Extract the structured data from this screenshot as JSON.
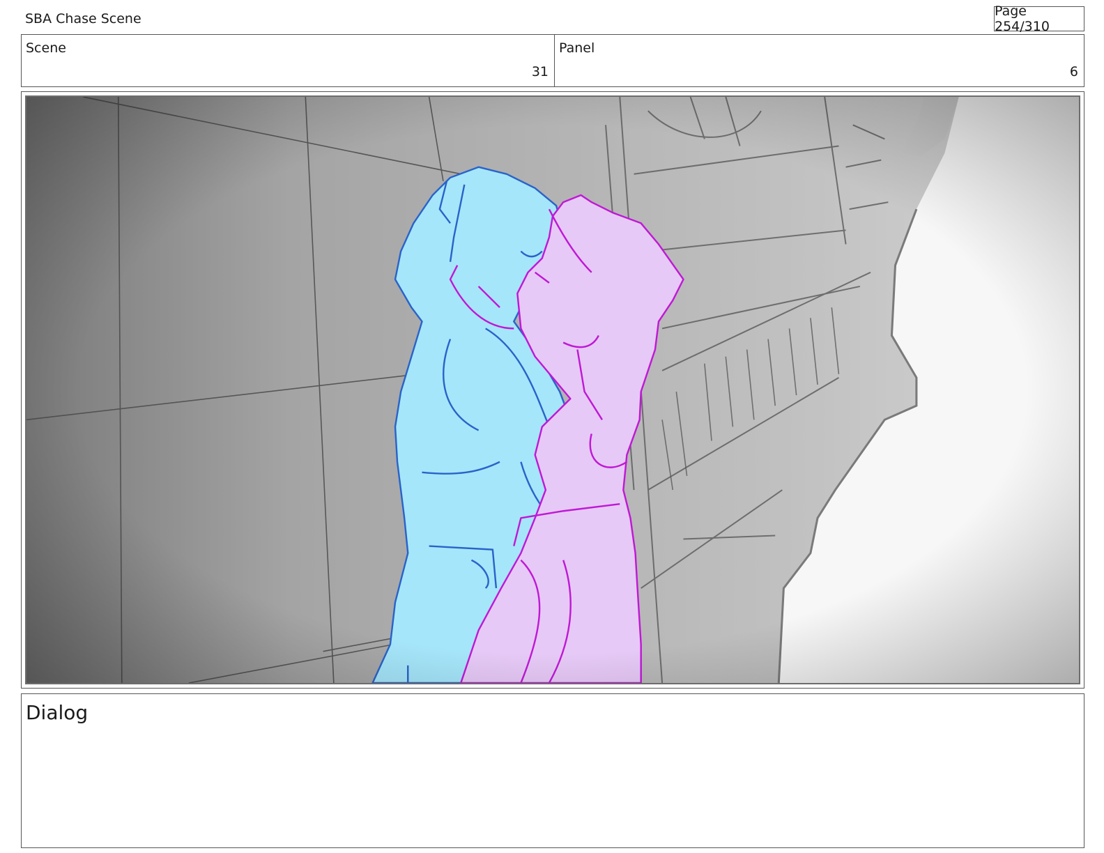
{
  "header": {
    "project_title": "SBA Chase Scene",
    "page_indicator": "Page 254/310"
  },
  "info": {
    "scene_label": "Scene",
    "scene_value": "31",
    "panel_label": "Panel",
    "panel_value": "6"
  },
  "storyboard_image": {
    "colors": {
      "wall": "#a6a6a6",
      "sky": "#ffffff",
      "character_blue_fill": "#a6e6fb",
      "character_blue_line": "#2a63c9",
      "character_pink_fill": "#e6c9f6",
      "character_pink_line": "#c018d6"
    }
  },
  "dialog": {
    "label": "Dialog"
  }
}
